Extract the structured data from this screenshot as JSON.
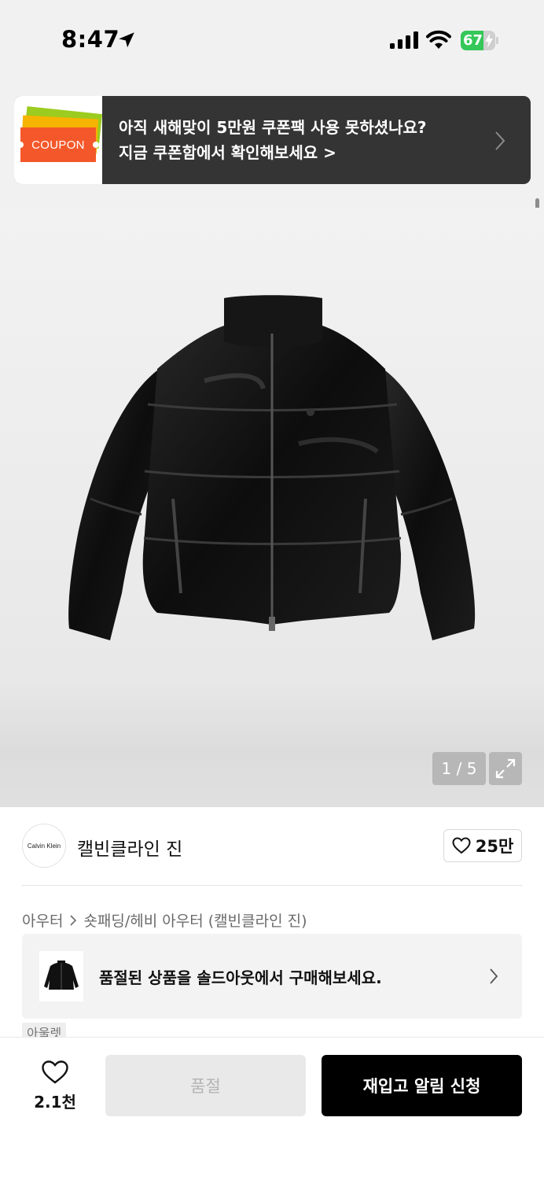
{
  "status_bar": {
    "time": "8:47",
    "battery_percent": "67",
    "battery_level": 0.67,
    "icons": [
      "location-arrow-icon",
      "signal-icon",
      "wifi-icon",
      "battery-charging-icon"
    ]
  },
  "coupon_banner": {
    "badge_label": "COUPON",
    "line1": "아직 새해맞이 5만원 쿠폰팩 사용 못하셨나요?",
    "line2": "지금 쿠폰함에서 확인해보세요 >",
    "colors": {
      "background": "#343434",
      "ticket_red": "#f4582a",
      "ticket_yellow": "#f5b400",
      "ticket_green": "#9bcc1f"
    }
  },
  "gallery": {
    "counter": "1 / 5",
    "icons": [
      "expand-icon"
    ]
  },
  "brand": {
    "logo_text": "Calvin Klein",
    "name": "캘빈클라인 진",
    "like_count": "25만"
  },
  "breadcrumb": {
    "items": [
      "아우터",
      "숏패딩/헤비 아우터 (캘빈클라인 진)"
    ]
  },
  "soldout_notice": {
    "message": "품절된 상품을 솔드아웃에서 구매해보세요."
  },
  "tags": [
    "아울렛"
  ],
  "bottom_bar": {
    "wish_count": "2.1천",
    "soldout_label": "품절",
    "restock_label": "재입고 알림 신청",
    "colors": {
      "primary": "#000000",
      "disabled": "#e9e9e9"
    }
  }
}
